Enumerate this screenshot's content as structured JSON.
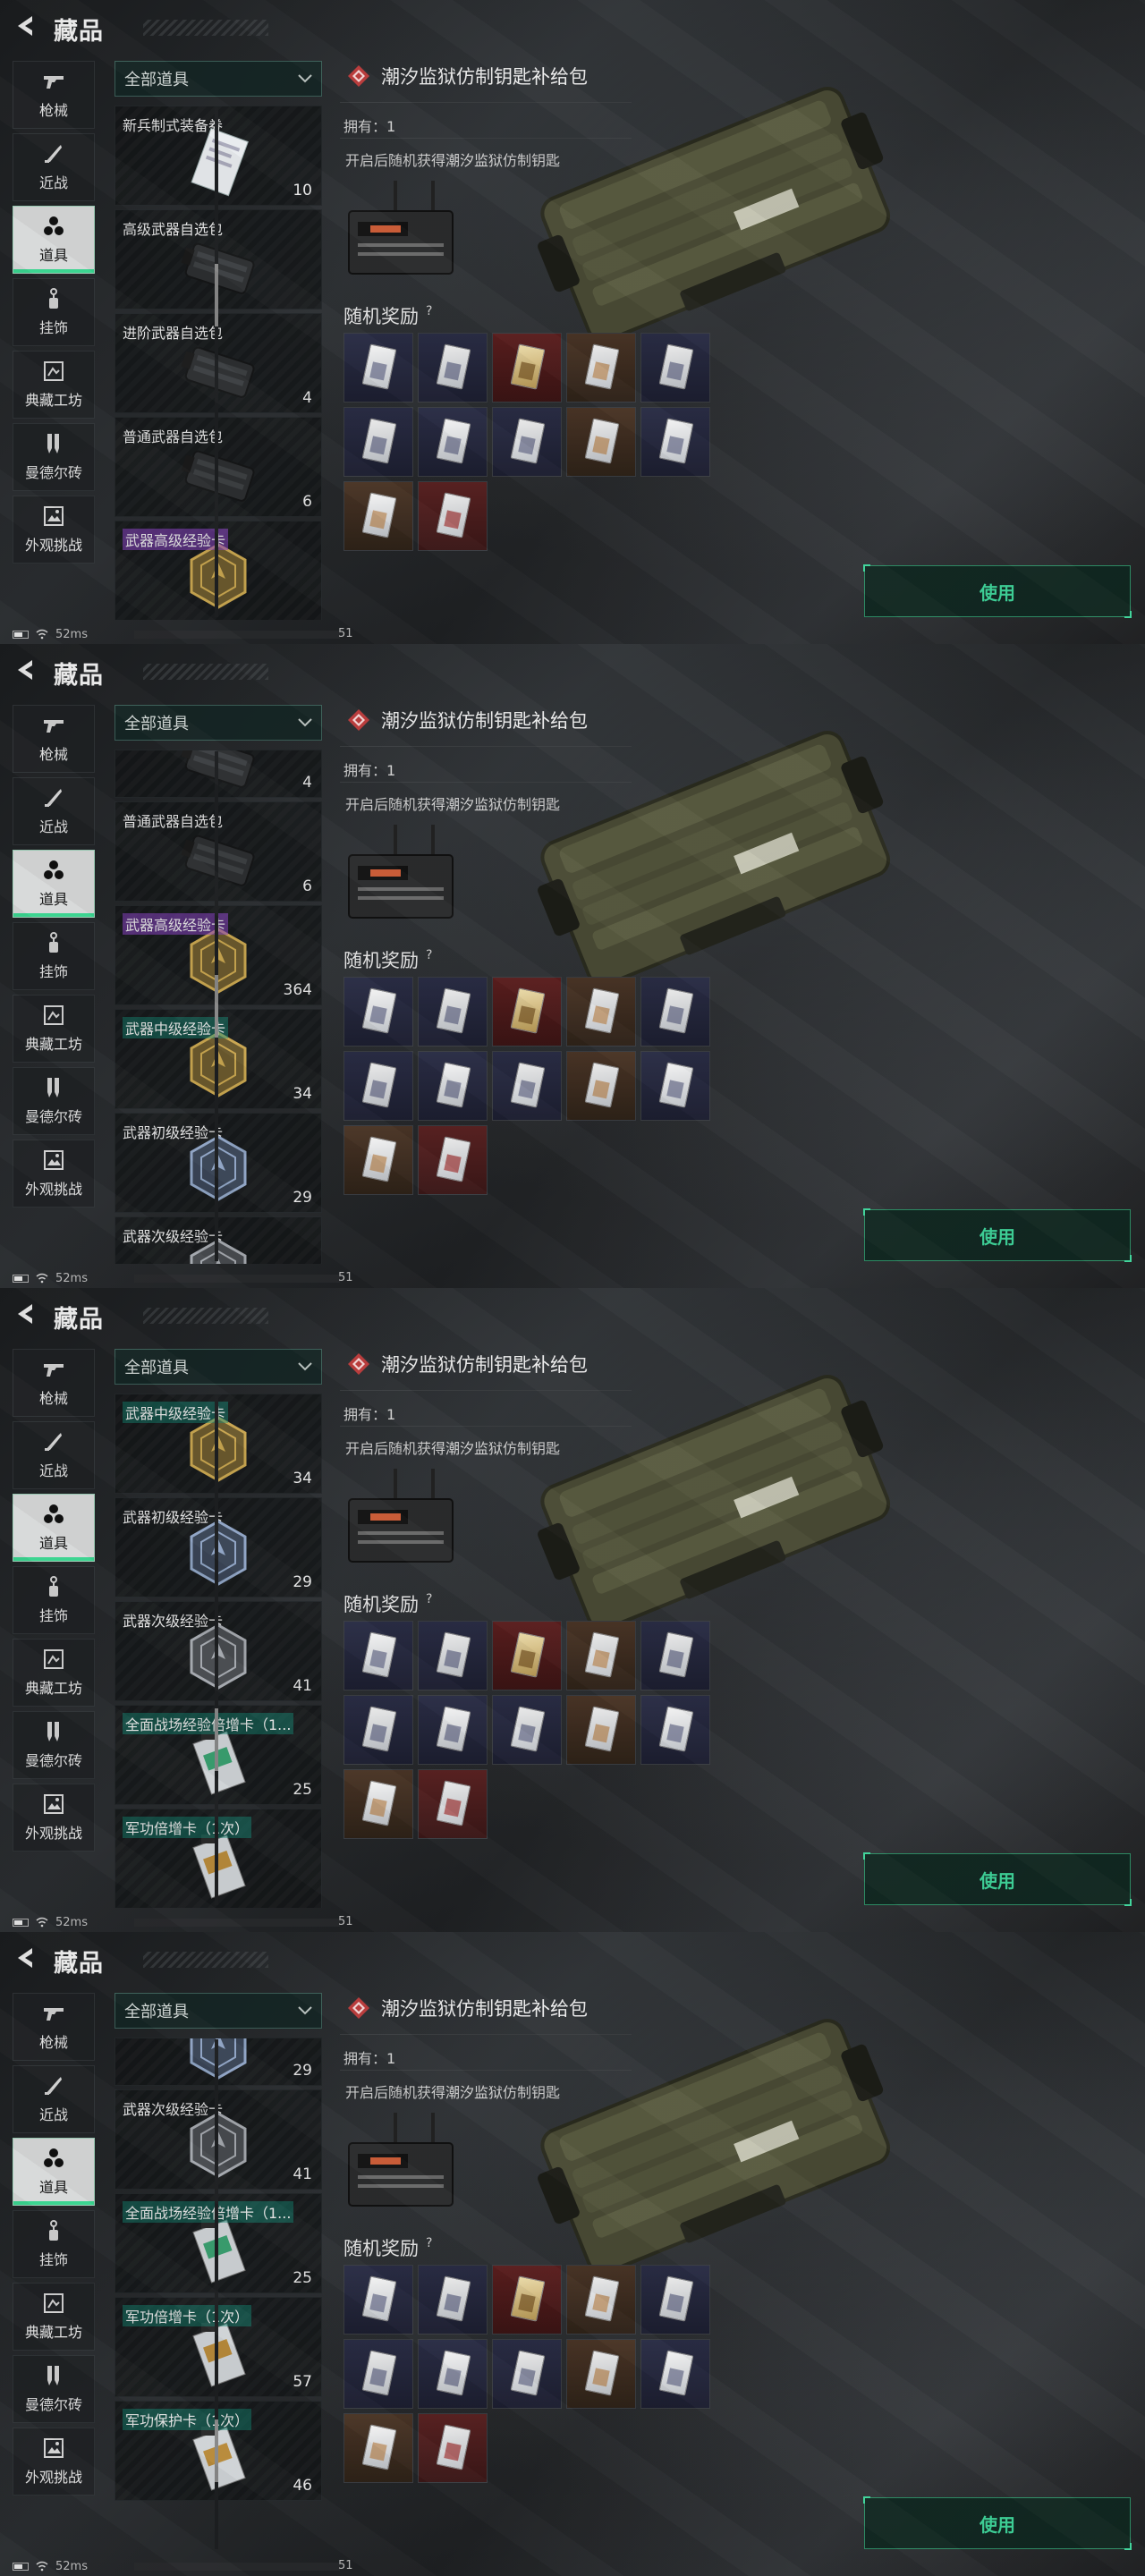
{
  "header": {
    "title": "藏品"
  },
  "sidebar": {
    "items": [
      {
        "label": "枪械",
        "icon": "gun-icon"
      },
      {
        "label": "近战",
        "icon": "knife-icon"
      },
      {
        "label": "道具",
        "icon": "items-icon",
        "active": true
      },
      {
        "label": "挂饰",
        "icon": "charm-icon"
      },
      {
        "label": "典藏工坊",
        "icon": "workshop-icon"
      },
      {
        "label": "曼德尔砖",
        "icon": "brick-icon"
      },
      {
        "label": "外观挑战",
        "icon": "challenge-icon"
      }
    ]
  },
  "filter": {
    "selected": "全部道具"
  },
  "detail": {
    "title": "潮汐监狱仿制钥匙补给包",
    "owned": "拥有：1",
    "description": "开启后随机获得潮汐监狱仿制钥匙",
    "reward_title": "随机奖励",
    "reward_help": "?",
    "use_label": "使用"
  },
  "rewards": [
    "blue",
    "blue",
    "gold",
    "orange",
    "blue",
    "blue",
    "blue",
    "blue",
    "orange",
    "blue",
    "orange",
    "red"
  ],
  "status": {
    "ping": "52ms",
    "fps": "51"
  },
  "frames": [
    {
      "scroll_fraction": 0.35,
      "items": [
        {
          "name": "新兵制式装备券",
          "count": "10",
          "type": "ticket",
          "tone": ""
        },
        {
          "name": "高级武器自选包",
          "count": "",
          "type": "case",
          "tone": ""
        },
        {
          "name": "进阶武器自选包",
          "count": "4",
          "type": "case",
          "tone": ""
        },
        {
          "name": "普通武器自选包",
          "count": "6",
          "type": "case",
          "tone": ""
        },
        {
          "name": "武器高级经验卡",
          "count": "",
          "type": "hex-gold",
          "tone": "purple"
        }
      ]
    },
    {
      "scroll_fraction": 0.5,
      "items": [
        {
          "name": "",
          "count": "4",
          "type": "case",
          "tone": "",
          "partial": true
        },
        {
          "name": "普通武器自选包",
          "count": "6",
          "type": "case",
          "tone": ""
        },
        {
          "name": "武器高级经验卡",
          "count": "364",
          "type": "hex-gold",
          "tone": "purple"
        },
        {
          "name": "武器中级经验卡",
          "count": "34",
          "type": "hex-gold",
          "tone": "green"
        },
        {
          "name": "武器初级经验卡",
          "count": "29",
          "type": "hex-blue",
          "tone": ""
        },
        {
          "name": "武器次级经验卡",
          "count": "",
          "type": "hex-grey",
          "tone": ""
        }
      ]
    },
    {
      "scroll_fraction": 0.7,
      "items": [
        {
          "name": "武器中级经验卡",
          "count": "34",
          "type": "hex-gold",
          "tone": "green"
        },
        {
          "name": "武器初级经验卡",
          "count": "29",
          "type": "hex-blue",
          "tone": ""
        },
        {
          "name": "武器次级经验卡",
          "count": "41",
          "type": "hex-grey",
          "tone": ""
        },
        {
          "name": "全面战场经验倍增卡（1...",
          "count": "25",
          "type": "ticket-green",
          "tone": "green"
        },
        {
          "name": "军功倍增卡（1次）",
          "count": "",
          "type": "ticket-gold",
          "tone": "green"
        }
      ]
    },
    {
      "scroll_fraction": 0.85,
      "items": [
        {
          "name": "",
          "count": "29",
          "type": "hex-blue",
          "tone": "",
          "partial": true
        },
        {
          "name": "武器次级经验卡",
          "count": "41",
          "type": "hex-grey",
          "tone": ""
        },
        {
          "name": "全面战场经验倍增卡（1...",
          "count": "25",
          "type": "ticket-green",
          "tone": "green"
        },
        {
          "name": "军功倍增卡（1次）",
          "count": "57",
          "type": "ticket-gold",
          "tone": "green"
        },
        {
          "name": "军功保护卡（1次）",
          "count": "46",
          "type": "ticket-gold",
          "tone": "green"
        }
      ]
    }
  ]
}
